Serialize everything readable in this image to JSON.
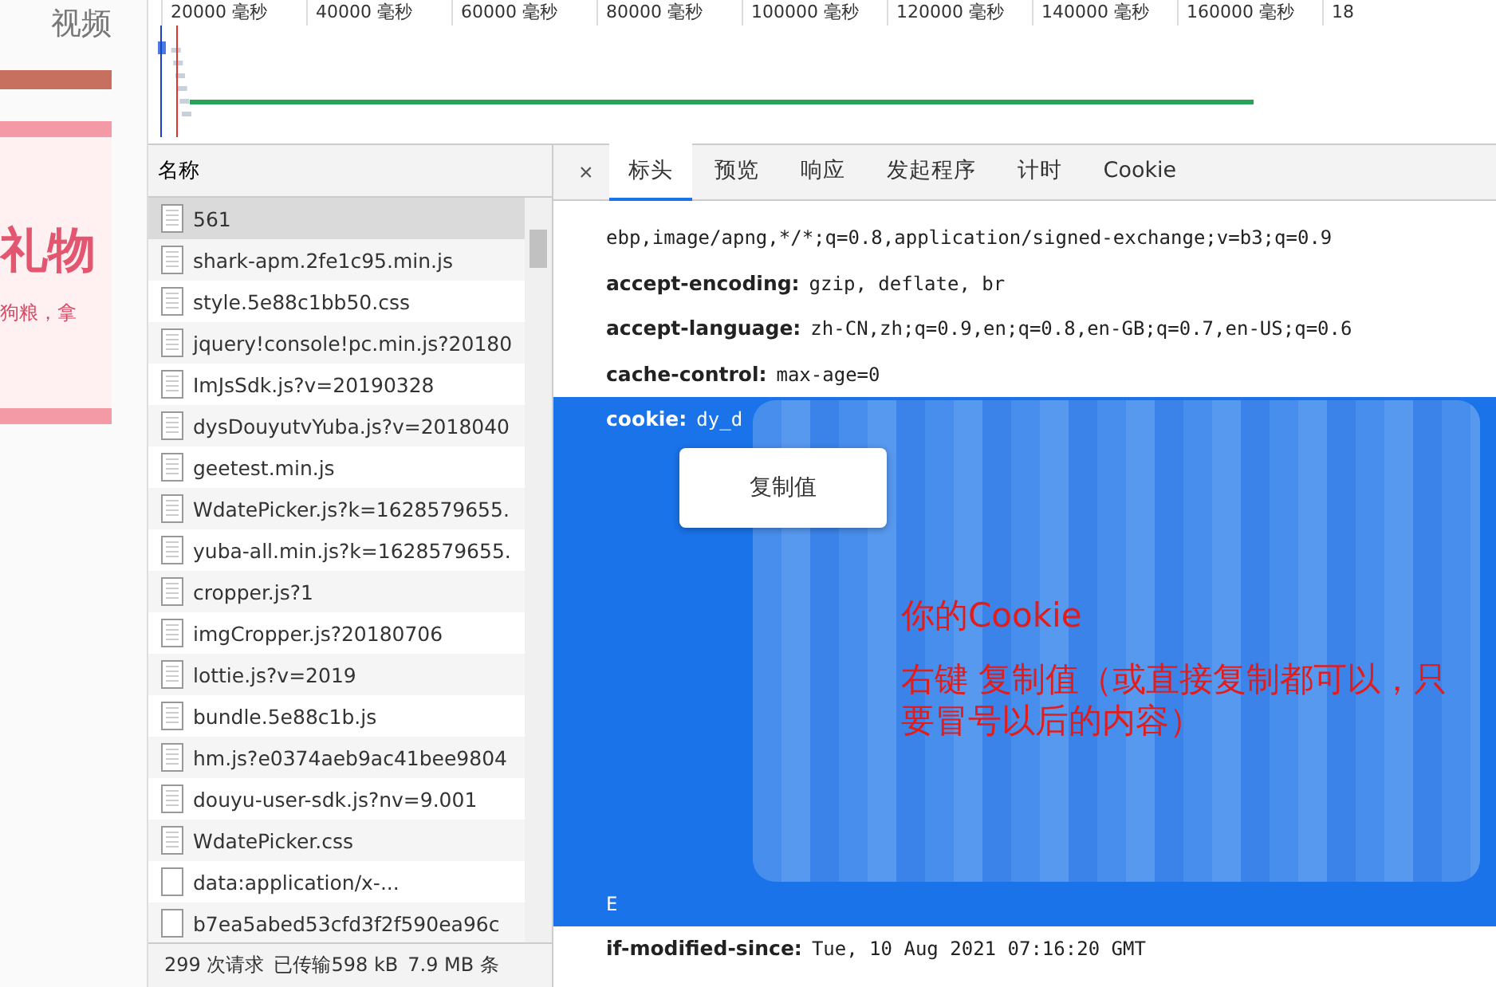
{
  "page_strip": {
    "nav_label": "视频",
    "banner_title": "礼物",
    "banner_subtitle": "狗粮，拿"
  },
  "timeline": {
    "ticks": [
      "20000 毫秒",
      "40000 毫秒",
      "60000 毫秒",
      "80000 毫秒",
      "100000 毫秒",
      "120000 毫秒",
      "140000 毫秒",
      "160000 毫秒",
      "18"
    ]
  },
  "request_list": {
    "header": "名称",
    "rows": [
      {
        "name": "561",
        "kind": "doc",
        "selected": true
      },
      {
        "name": "shark-apm.2fe1c95.min.js",
        "kind": "doc",
        "selected": false
      },
      {
        "name": "style.5e88c1bb50.css",
        "kind": "doc",
        "selected": false
      },
      {
        "name": "jquery!console!pc.min.js?20180",
        "kind": "doc",
        "selected": false
      },
      {
        "name": "ImJsSdk.js?v=20190328",
        "kind": "doc",
        "selected": false
      },
      {
        "name": "dysDouyutvYuba.js?v=2018040",
        "kind": "doc",
        "selected": false
      },
      {
        "name": "geetest.min.js",
        "kind": "doc",
        "selected": false
      },
      {
        "name": "WdatePicker.js?k=1628579655.",
        "kind": "doc",
        "selected": false
      },
      {
        "name": "yuba-all.min.js?k=1628579655.",
        "kind": "doc",
        "selected": false
      },
      {
        "name": "cropper.js?1",
        "kind": "doc",
        "selected": false
      },
      {
        "name": "imgCropper.js?20180706",
        "kind": "doc",
        "selected": false
      },
      {
        "name": "lottie.js?v=2019",
        "kind": "doc",
        "selected": false
      },
      {
        "name": "bundle.5e88c1b.js",
        "kind": "doc",
        "selected": false
      },
      {
        "name": "hm.js?e0374aeb9ac41bee9804",
        "kind": "doc",
        "selected": false
      },
      {
        "name": "douyu-user-sdk.js?nv=9.001",
        "kind": "doc",
        "selected": false
      },
      {
        "name": "WdatePicker.css",
        "kind": "doc",
        "selected": false
      },
      {
        "name": "data:application/x-...",
        "kind": "blank",
        "selected": false
      },
      {
        "name": "b7ea5abed53cfd3f2f590ea96c",
        "kind": "blank",
        "selected": false
      }
    ]
  },
  "status_bar": [
    "299 次请求",
    "已传输598 kB",
    "7.9 MB 条"
  ],
  "close_button": "×",
  "tabs": [
    {
      "label": "标头",
      "selected": true
    },
    {
      "label": "预览",
      "selected": false
    },
    {
      "label": "响应",
      "selected": false
    },
    {
      "label": "发起程序",
      "selected": false
    },
    {
      "label": "计时",
      "selected": false
    },
    {
      "label": "Cookie",
      "selected": false
    }
  ],
  "headers": [
    {
      "value": "ebp,image/apng,*/*;q=0.8,application/signed-exchange;v=b3;q=0.9",
      "selected": false
    },
    {
      "name": "accept-encoding:",
      "value": "gzip, deflate, br",
      "selected": false
    },
    {
      "name": "accept-language:",
      "value": "zh-CN,zh;q=0.9,en;q=0.8,en-GB;q=0.7,en-US;q=0.6",
      "selected": false
    },
    {
      "name": "cache-control:",
      "value": "max-age=0",
      "selected": false
    },
    {
      "name": "cookie:",
      "value": "dy_d",
      "selected": true,
      "redacted": true,
      "last_line": "E"
    },
    {
      "name": "if-modified-since:",
      "value": "Tue, 10 Aug 2021 07:16:20 GMT",
      "selected": false
    }
  ],
  "context_menu": {
    "item": "复制值"
  },
  "annotation": {
    "title": "你的Cookie",
    "note": "右键 复制值（或直接复制都可以，只要冒号以后的内容）"
  }
}
